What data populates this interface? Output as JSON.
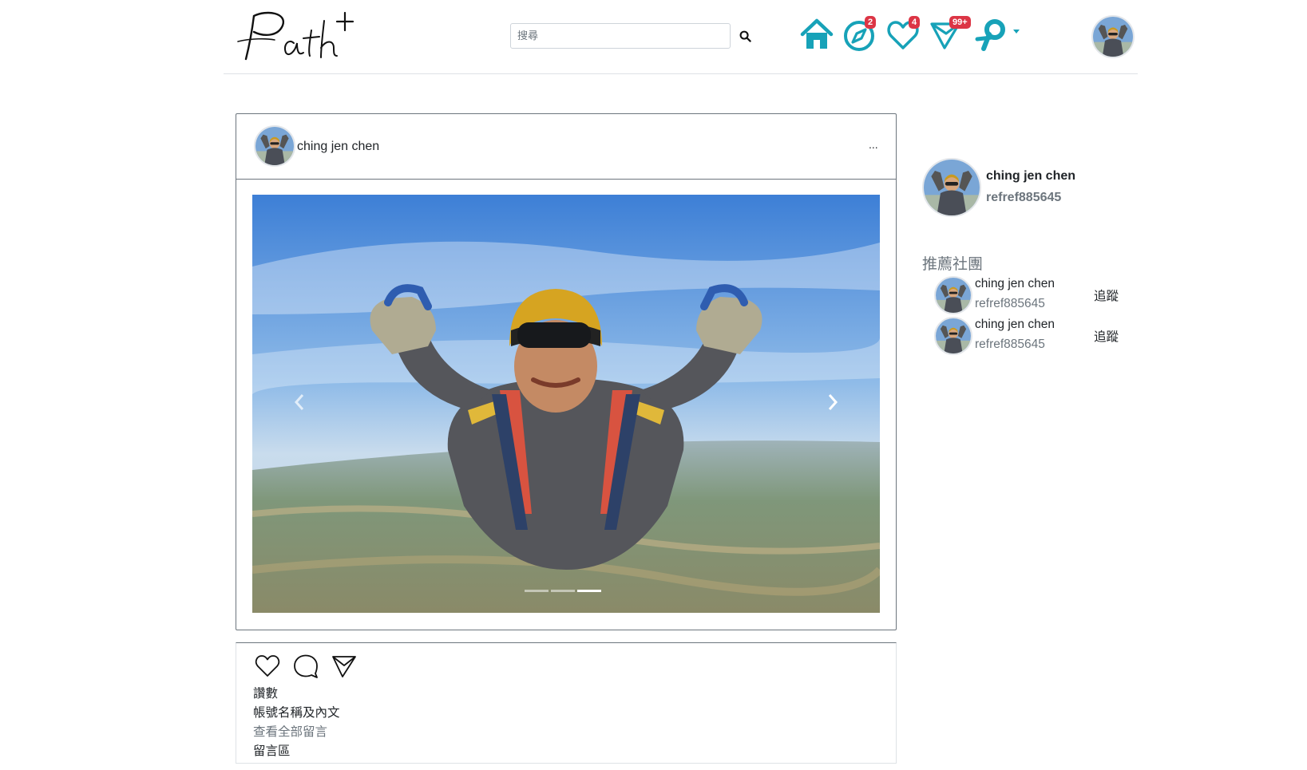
{
  "brand": {
    "logo_text": "Path+",
    "accent": "#17a2b8",
    "badge_color": "#dc3545"
  },
  "header": {
    "search": {
      "placeholder": "搜尋",
      "value": "",
      "button_icon": "search-icon"
    },
    "nav": [
      {
        "icon": "home-icon",
        "badge": ""
      },
      {
        "icon": "compass-icon",
        "badge": "2"
      },
      {
        "icon": "heart-icon",
        "badge": "4"
      },
      {
        "icon": "send-icon",
        "badge": "99+"
      },
      {
        "icon": "path-logo-dropdown-icon",
        "badge": ""
      }
    ],
    "user_avatar_icon": "user-avatar"
  },
  "post": {
    "author": "ching jen chen",
    "more_label": "...",
    "image_alt": "skydiver-photo",
    "carousel": {
      "slides": 3,
      "active": 3,
      "prev_icon": "chevron-left-icon",
      "next_icon": "chevron-right-icon"
    },
    "actions": [
      {
        "icon": "heart-outline-icon"
      },
      {
        "icon": "comment-icon"
      },
      {
        "icon": "share-icon"
      }
    ],
    "likes_label": "讚數",
    "caption_label": "帳號名稱及內文",
    "view_comments_label": "查看全部留言",
    "comment_area_label": "留言區"
  },
  "sidebar": {
    "profile": {
      "name": "ching jen chen",
      "id": "refref885645"
    },
    "recommend_title": "推薦社團",
    "recommendations": [
      {
        "name": "ching jen chen",
        "id": "refref885645",
        "follow_label": "追蹤"
      },
      {
        "name": "ching jen chen",
        "id": "refref885645",
        "follow_label": "追蹤"
      }
    ]
  }
}
